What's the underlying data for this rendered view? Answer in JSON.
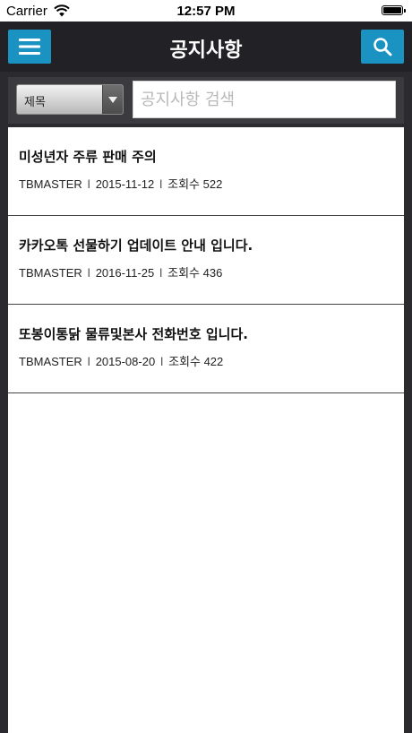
{
  "status_bar": {
    "carrier": "Carrier",
    "time": "12:57 PM",
    "icons": [
      "wifi-icon",
      "battery-icon"
    ]
  },
  "nav": {
    "title": "공지사항",
    "menu_icon": "hamburger-menu-icon",
    "search_icon": "search-icon",
    "button_color": "#1a93c2"
  },
  "search": {
    "field_selected": "제목",
    "placeholder": "공지사항 검색"
  },
  "notices": [
    {
      "title": "미성년자 주류 판매 주의",
      "author": "TBMASTER",
      "date": "2015-11-12",
      "views": "조회수 522"
    },
    {
      "title": "카카오톡 선물하기 업데이트 안내 입니다.",
      "author": "TBMASTER",
      "date": "2016-11-25",
      "views": "조회수 436"
    },
    {
      "title": "또봉이통닭 물류및본사 전화번호 입니다.",
      "author": "TBMASTER",
      "date": "2015-08-20",
      "views": "조회수 422"
    }
  ],
  "meta_separator": "l"
}
